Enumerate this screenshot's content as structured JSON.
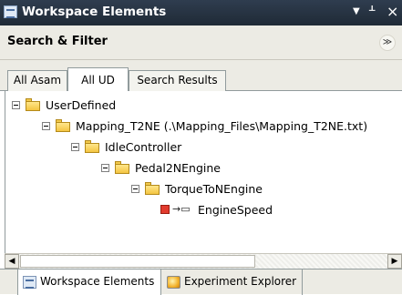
{
  "window": {
    "title": "Workspace Elements",
    "controls": {
      "dropdown": "▼",
      "pin": "ᚆ",
      "close": "×"
    }
  },
  "search": {
    "label": "Search & Filter",
    "toggle_icon": "≫"
  },
  "tabs": [
    {
      "label": "All Asam",
      "active": false
    },
    {
      "label": "All UD",
      "active": true
    },
    {
      "label": "Search Results",
      "active": false
    }
  ],
  "tree": {
    "nodes": [
      {
        "label": "UserDefined",
        "type": "folder",
        "expanded": true
      },
      {
        "label": "Mapping_T2NE (.\\Mapping_Files\\Mapping_T2NE.txt)",
        "type": "folder",
        "expanded": true
      },
      {
        "label": "IdleController",
        "type": "folder",
        "expanded": true
      },
      {
        "label": "Pedal2NEngine",
        "type": "folder",
        "expanded": true
      },
      {
        "label": "TorqueToNEngine",
        "type": "folder",
        "expanded": true
      },
      {
        "label": "EngineSpeed",
        "type": "signal",
        "arrow": "→▭"
      }
    ]
  },
  "bottom_tabs": [
    {
      "label": "Workspace Elements",
      "active": true,
      "icon": "workspace-icon"
    },
    {
      "label": "Experiment Explorer",
      "active": false,
      "icon": "experiment-icon"
    }
  ],
  "colors": {
    "titlebar": "#2b3746",
    "panel": "#ecebe4",
    "signal": "#e23b2e",
    "folder": "#f4c542"
  }
}
